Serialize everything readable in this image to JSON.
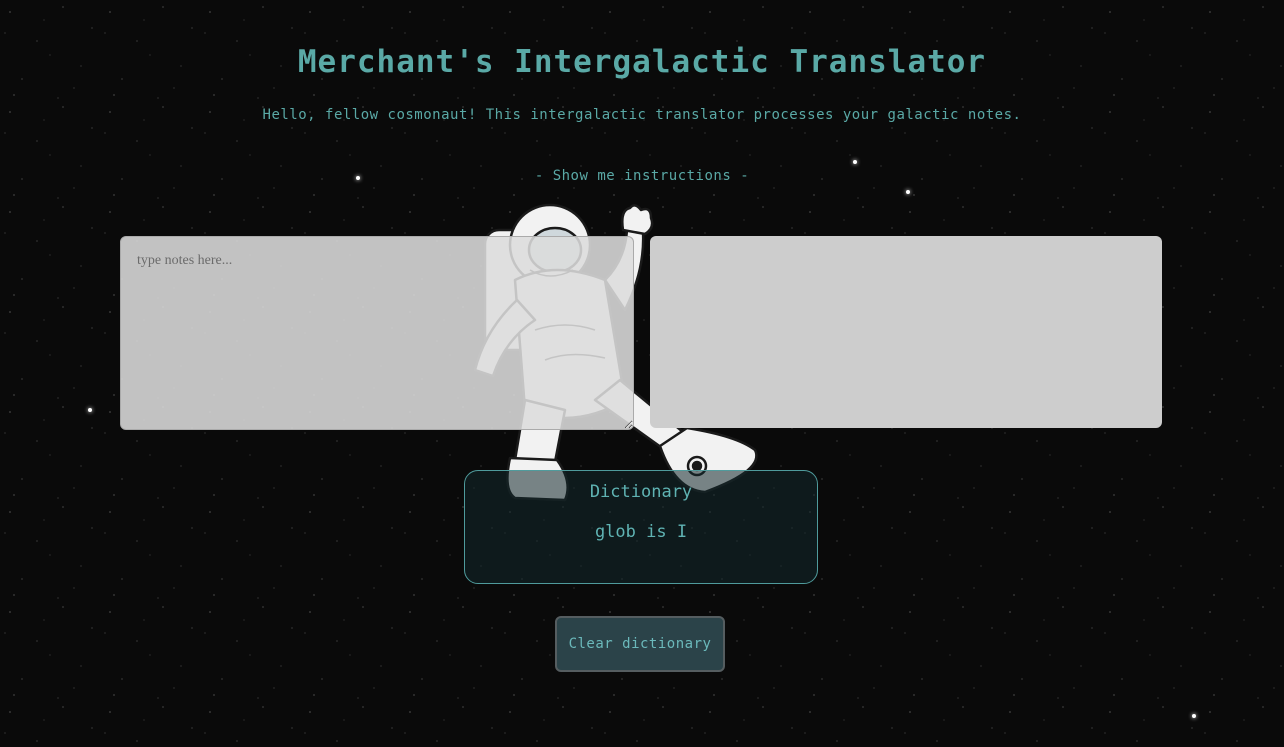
{
  "header": {
    "title": "Merchant's Intergalactic Translator",
    "subtitle": "Hello, fellow cosmonaut! This intergalactic translator processes your galactic notes."
  },
  "instructions": {
    "toggle_label": "- Show me instructions -"
  },
  "notes": {
    "value": "",
    "placeholder": "type notes here..."
  },
  "output": {
    "text": ""
  },
  "dictionary": {
    "title": "Dictionary",
    "entries": [
      "glob is I"
    ]
  },
  "actions": {
    "clear_label": "Clear dictionary"
  },
  "colors": {
    "accent": "#5fb3b3",
    "background": "#0a0a0a",
    "panel": "#cdcdcd",
    "button": "#2b4349"
  },
  "icons": {
    "illustration": "astronaut-illustration"
  }
}
